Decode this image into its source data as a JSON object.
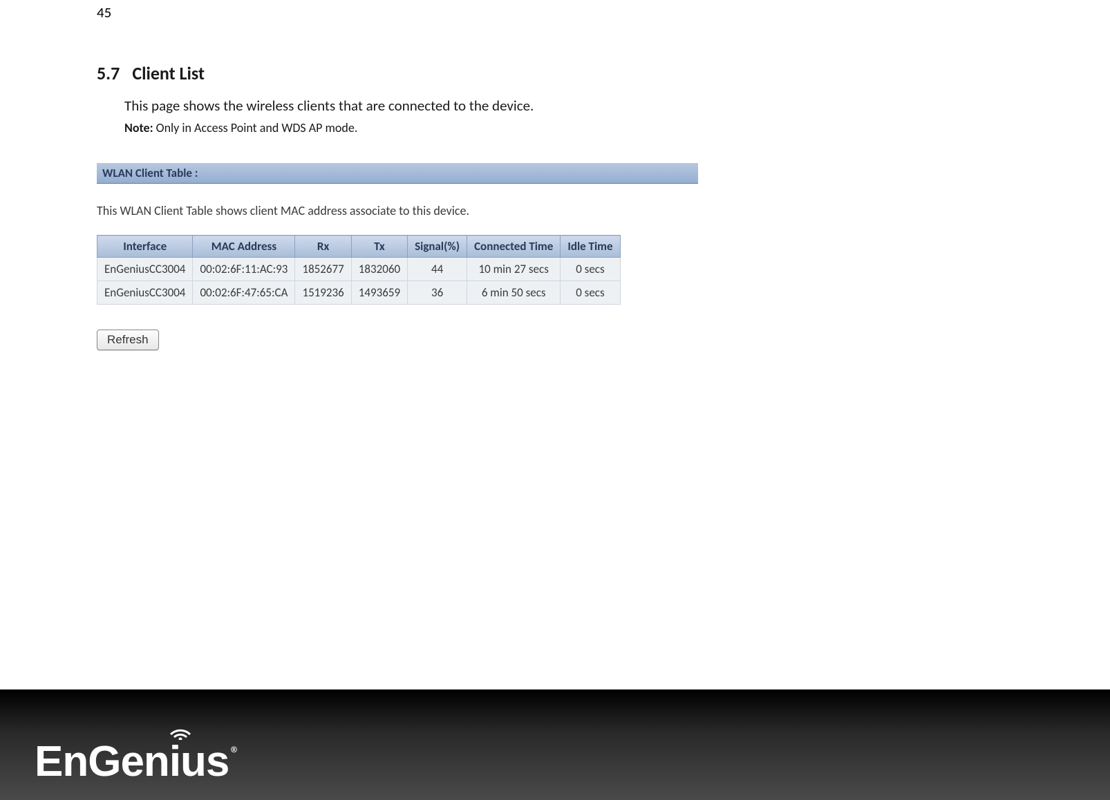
{
  "page_number": "45",
  "section": {
    "number": "5.7",
    "title": "Client List",
    "description": "This page shows the wireless clients that are connected to the device.",
    "note_label": "Note:",
    "note_text": " Only in Access Point and WDS AP mode."
  },
  "panel": {
    "title": "WLAN Client Table :",
    "description": "This WLAN Client Table shows client MAC address associate to this device."
  },
  "table": {
    "headers": [
      "Interface",
      "MAC Address",
      "Rx",
      "Tx",
      "Signal(%)",
      "Connected Time",
      "Idle Time"
    ],
    "rows": [
      {
        "interface": "EnGeniusCC3004",
        "mac": "00:02:6F:11:AC:93",
        "rx": "1852677",
        "tx": "1832060",
        "signal": "44",
        "connected": "10 min 27 secs",
        "idle": "0 secs"
      },
      {
        "interface": "EnGeniusCC3004",
        "mac": "00:02:6F:47:65:CA",
        "rx": "1519236",
        "tx": "1493659",
        "signal": "36",
        "connected": "6 min 50 secs",
        "idle": "0 secs"
      }
    ]
  },
  "buttons": {
    "refresh": "Refresh"
  },
  "logo": {
    "brand": "EnGenius",
    "registered": "®"
  }
}
